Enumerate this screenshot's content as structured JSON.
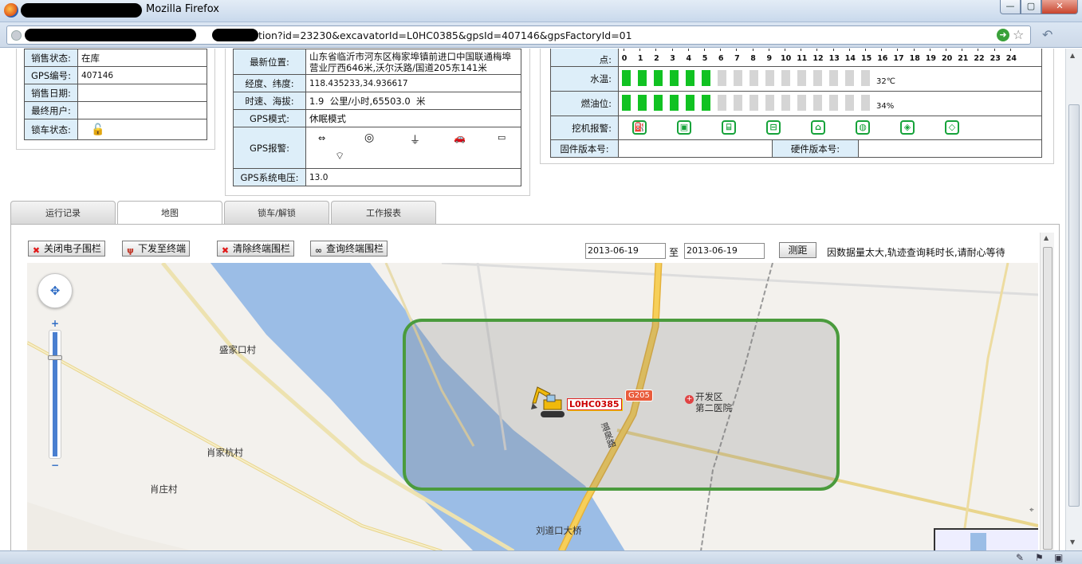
{
  "window": {
    "title": "Mozilla Firefox",
    "url": "tion?id=23230&excavatorId=L0HC0385&gpsId=407146&gpsFactoryId=01"
  },
  "left_table": {
    "rows": [
      {
        "label": "销售状态:",
        "value": "在库"
      },
      {
        "label": "GPS编号:",
        "value": "407146"
      },
      {
        "label": "销售日期:",
        "value": ""
      },
      {
        "label": "最终用户:",
        "value": ""
      },
      {
        "label": "锁车状态:",
        "value": ""
      }
    ]
  },
  "mid_table": {
    "location_label": "最新位置:",
    "location_value": "山东省临沂市河东区梅家埠镇前进口中国联通梅埠营业厅西646米,沃尔沃路/国道205东141米",
    "coords_label": "经度、纬度:",
    "coords_value": "118.435233,34.936617",
    "speed_label": "时速、海拔:",
    "speed_value": "1.9  公里/小时,65503.0  米",
    "mode_label": "GPS模式:",
    "mode_value": "休眠模式",
    "alarm_label": "GPS报警:",
    "voltage_label": "GPS系统电压:",
    "voltage_value": "13.0"
  },
  "right_panel": {
    "hours_label": "点:",
    "hours": [
      "0",
      "1",
      "2",
      "3",
      "4",
      "5",
      "6",
      "7",
      "8",
      "9",
      "10",
      "11",
      "12",
      "13",
      "14",
      "15",
      "16",
      "17",
      "18",
      "19",
      "20",
      "21",
      "22",
      "23",
      "24"
    ],
    "water_label": "水温:",
    "water_value": "32℃",
    "water_level": 6,
    "fuel_label": "燃油位:",
    "fuel_value": "34%",
    "fuel_level": 6,
    "total_bars": 16,
    "alarm_label": "挖机报警:",
    "firmware_label": "固件版本号:",
    "firmware_value": "",
    "hardware_label": "硬件版本号:",
    "hardware_value": "",
    "active_color": "#11c222",
    "inactive_color": "#d5d5d5"
  },
  "tabs": [
    "运行记录",
    "地图",
    "锁车/解锁",
    "工作报表"
  ],
  "active_tab": 1,
  "toolbar": {
    "close_fence": "关闭电子围栏",
    "send_terminal": "下发至终端",
    "clear_fence": "清除终端围栏",
    "query_fence": "查询终端围栏"
  },
  "date_from": "2013-06-19",
  "date_sep": "至",
  "date_to": "2013-06-19",
  "measure_btn": "测距",
  "notice": "因数据量太大,轨迹查询耗时长,请耐心等待",
  "map": {
    "labels": [
      "盛家口村",
      "肖家杭村",
      "肖庄村",
      "开发区",
      "第二医院",
      "刘道口大桥",
      "温泉路"
    ],
    "road_shield": "G205",
    "vehicle_id": "L0HC0385"
  }
}
